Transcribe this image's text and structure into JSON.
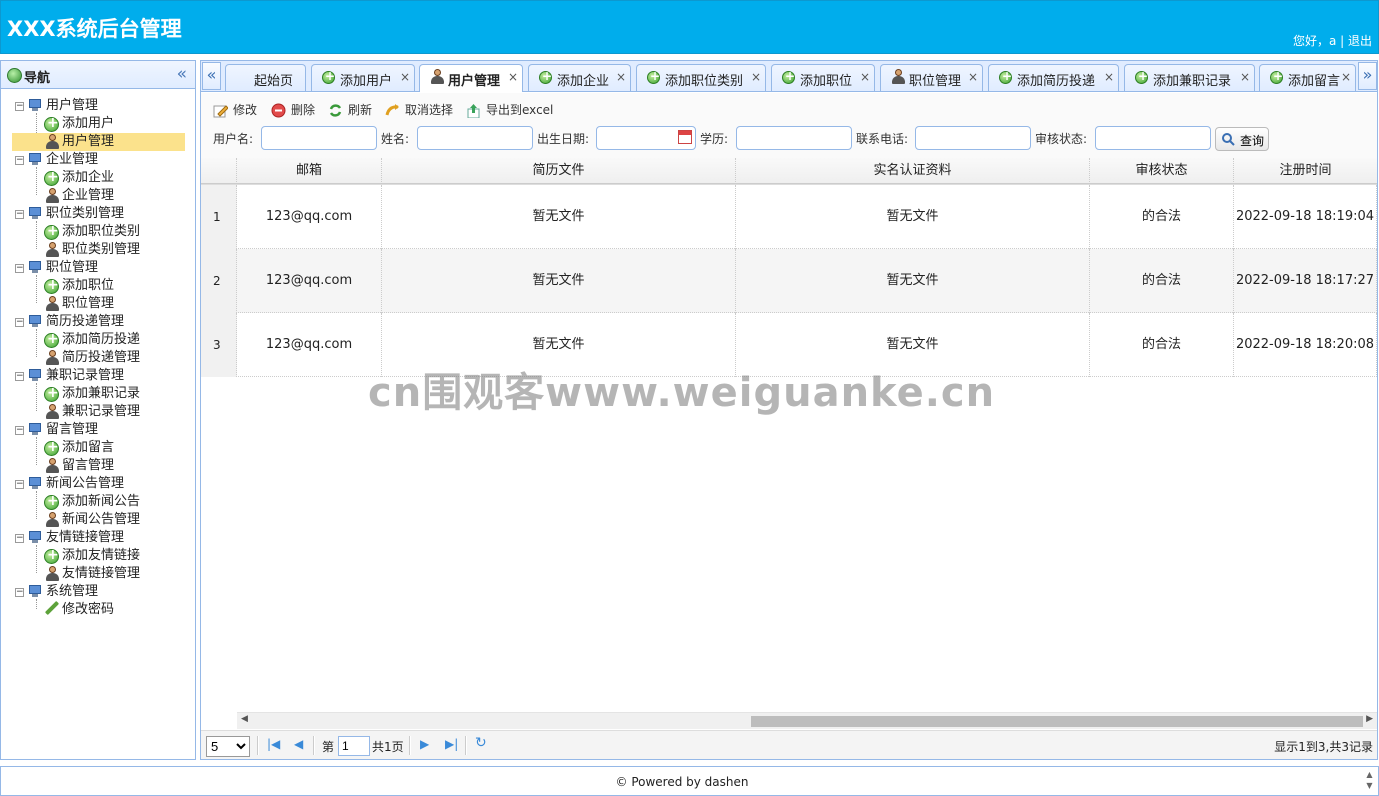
{
  "header": {
    "title": "XXX系统后台管理",
    "greeting": "您好，a |",
    "logout": "退出"
  },
  "nav": {
    "title": "导航",
    "groups": [
      {
        "label": "用户管理",
        "items": [
          {
            "label": "添加用户",
            "icon": "add-icon"
          },
          {
            "label": "用户管理",
            "icon": "user-icon"
          }
        ]
      },
      {
        "label": "企业管理",
        "items": [
          {
            "label": "添加企业",
            "icon": "add-icon"
          },
          {
            "label": "企业管理",
            "icon": "user-icon"
          }
        ]
      },
      {
        "label": "职位类别管理",
        "items": [
          {
            "label": "添加职位类别",
            "icon": "add-icon"
          },
          {
            "label": "职位类别管理",
            "icon": "user-icon"
          }
        ]
      },
      {
        "label": "职位管理",
        "items": [
          {
            "label": "添加职位",
            "icon": "add-icon"
          },
          {
            "label": "职位管理",
            "icon": "user-icon"
          }
        ]
      },
      {
        "label": "简历投递管理",
        "items": [
          {
            "label": "添加简历投递",
            "icon": "add-icon"
          },
          {
            "label": "简历投递管理",
            "icon": "user-icon"
          }
        ]
      },
      {
        "label": "兼职记录管理",
        "items": [
          {
            "label": "添加兼职记录",
            "icon": "add-icon"
          },
          {
            "label": "兼职记录管理",
            "icon": "user-icon"
          }
        ]
      },
      {
        "label": "留言管理",
        "items": [
          {
            "label": "添加留言",
            "icon": "add-icon"
          },
          {
            "label": "留言管理",
            "icon": "user-icon"
          }
        ]
      },
      {
        "label": "新闻公告管理",
        "items": [
          {
            "label": "添加新闻公告",
            "icon": "add-icon"
          },
          {
            "label": "新闻公告管理",
            "icon": "user-icon"
          }
        ]
      },
      {
        "label": "友情链接管理",
        "items": [
          {
            "label": "添加友情链接",
            "icon": "add-icon"
          },
          {
            "label": "友情链接管理",
            "icon": "user-icon"
          }
        ]
      },
      {
        "label": "系统管理",
        "items": [
          {
            "label": "修改密码",
            "icon": "pencil-icon"
          }
        ]
      }
    ]
  },
  "tabs": [
    {
      "label": "起始页",
      "icon": "none",
      "closable": false
    },
    {
      "label": "添加用户",
      "icon": "add-icon",
      "closable": true
    },
    {
      "label": "用户管理",
      "icon": "user-icon",
      "closable": true,
      "active": true
    },
    {
      "label": "添加企业",
      "icon": "add-icon",
      "closable": true
    },
    {
      "label": "添加职位类别",
      "icon": "add-icon",
      "closable": true
    },
    {
      "label": "添加职位",
      "icon": "add-icon",
      "closable": true
    },
    {
      "label": "职位管理",
      "icon": "user-icon",
      "closable": true
    },
    {
      "label": "添加简历投递",
      "icon": "add-icon",
      "closable": true
    },
    {
      "label": "添加兼职记录",
      "icon": "add-icon",
      "closable": true
    },
    {
      "label": "添加留言",
      "icon": "add-icon",
      "closable": true
    }
  ],
  "toolbar": {
    "edit": "修改",
    "delete": "删除",
    "refresh": "刷新",
    "cancel_select": "取消选择",
    "export": "导出到excel"
  },
  "filters": {
    "username_label": "用户名:",
    "username_value": "",
    "name_label": "姓名:",
    "name_value": "",
    "birth_label": "出生日期:",
    "birth_value": "",
    "edu_label": "学历:",
    "edu_value": "",
    "phone_label": "联系电话:",
    "phone_value": "",
    "status_label": "审核状态:",
    "status_value": "",
    "search_label": "查询"
  },
  "grid": {
    "columns": [
      "邮箱",
      "简历文件",
      "实名认证资料",
      "审核状态",
      "注册时间"
    ],
    "rows": [
      {
        "num": "1",
        "email": "123@qq.com",
        "resume": "暂无文件",
        "cert": "暂无文件",
        "status": "的合法",
        "time": "2022-09-18 18:19:04"
      },
      {
        "num": "2",
        "email": "123@qq.com",
        "resume": "暂无文件",
        "cert": "暂无文件",
        "status": "的合法",
        "time": "2022-09-18 18:17:27"
      },
      {
        "num": "3",
        "email": "123@qq.com",
        "resume": "暂无文件",
        "cert": "暂无文件",
        "status": "的合法",
        "time": "2022-09-18 18:20:08"
      }
    ]
  },
  "pager": {
    "page_size": "5",
    "page_prefix": "第",
    "page_value": "1",
    "page_total": "共1页",
    "info": "显示1到3,共3记录"
  },
  "footer": {
    "text": "© Powered by dashen"
  },
  "watermark": "cn围观客www.weiguanke.cn"
}
